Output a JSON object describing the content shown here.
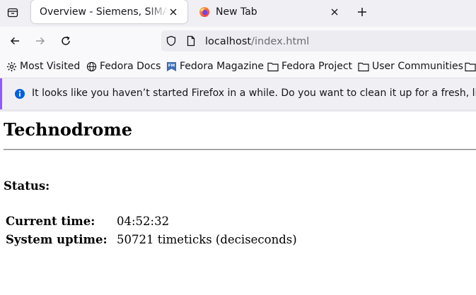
{
  "browser": {
    "tabs": [
      {
        "title": "Overview - Siemens, SIMATIC",
        "active": true
      },
      {
        "title": "New Tab",
        "active": false
      }
    ],
    "url_host": "localhost",
    "url_path": "/index.html",
    "bookmarks": [
      {
        "label": "Most Visited",
        "icon": "gear-icon"
      },
      {
        "label": "Fedora Docs",
        "icon": "globe-icon"
      },
      {
        "label": "Fedora Magazine",
        "icon": "fedora-magazine-icon"
      },
      {
        "label": "Fedora Project",
        "icon": "folder-icon"
      },
      {
        "label": "User Communities",
        "icon": "folder-icon"
      },
      {
        "label": "",
        "icon": "folder-icon"
      }
    ],
    "notification": "It looks like you haven’t started Firefox in a while. Do you want to clean it up for a fresh, like-new experience?",
    "colors": {
      "accent": "#9059ff",
      "info": "#0060df"
    }
  },
  "page": {
    "title": "Technodrome",
    "status_heading": "Status:",
    "rows": [
      {
        "label": "Current time:",
        "value": "04:52:32"
      },
      {
        "label": "System uptime:",
        "value": "50721 timeticks (deciseconds)"
      }
    ]
  }
}
